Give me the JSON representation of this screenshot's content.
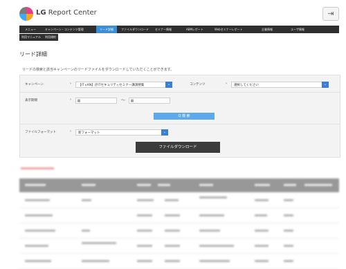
{
  "header": {
    "brand_prefix": "LG",
    "brand_suffix": "Report Center",
    "logout_icon": "logout-icon"
  },
  "nav": {
    "primary": [
      {
        "label": "メニュー",
        "active": false
      },
      {
        "label": "キャンペーン・コンテンツ管理",
        "active": false
      },
      {
        "label": "リード詳細",
        "active": true
      },
      {
        "label": "ファイルダウンロード",
        "active": false
      },
      {
        "label": "セミナー情報",
        "active": false
      },
      {
        "label": "ABMレポート",
        "active": false
      },
      {
        "label": "Webセミナーレポート",
        "active": false
      },
      {
        "label": "企業情報",
        "active": false
      },
      {
        "label": "ユーザ情報",
        "active": false
      }
    ],
    "secondary": [
      {
        "label": "利用マニュアル"
      },
      {
        "label": "利用規約"
      }
    ]
  },
  "page": {
    "title": "リード詳細",
    "description": "リードの検索と該当キャンペーンのリードファイルをダウンロードしていただくことができます。"
  },
  "form": {
    "campaign_label": "キャンペーン",
    "campaign_value": "【ITｘKN】＠ITセキュリティセミナー講演特集",
    "content_label": "コンテンツ",
    "content_placeholder": "選択してください",
    "period_label": "表示期間",
    "period_separator": "～",
    "search_label": "Q 検 索",
    "format_label": "ファイルフォーマット",
    "format_value": "新フォーマット",
    "download_label": "ファイルダウンロード"
  },
  "colors": {
    "nav_bg": "#2f2f2f",
    "nav_active": "#3a8fd8",
    "dropdown": "#3a7fd5",
    "search_button": "#5ea8ec",
    "download_button": "#3c3c3c"
  }
}
